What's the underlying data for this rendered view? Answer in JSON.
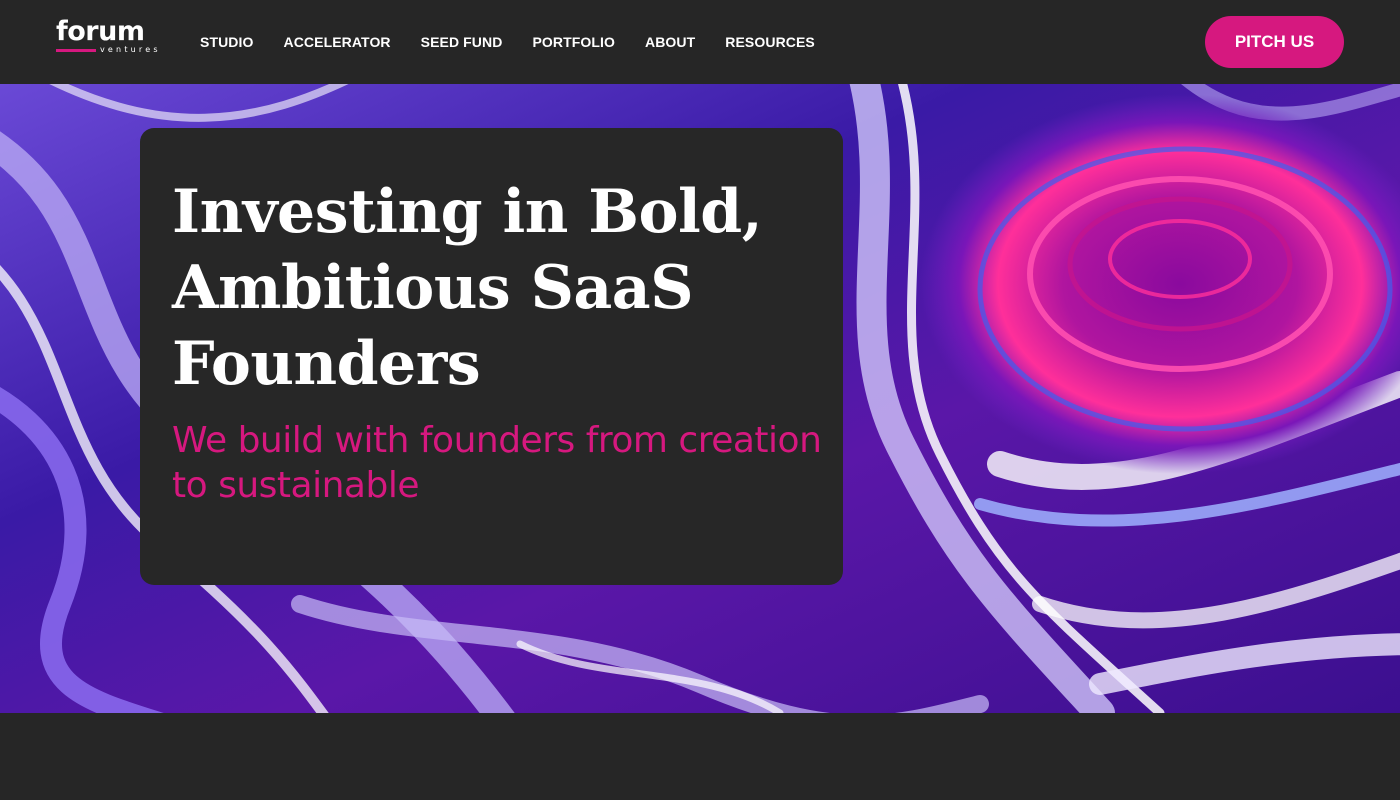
{
  "brand": {
    "name": "forum",
    "tagline": "ventures",
    "accent_color": "#d6187f",
    "background_color": "#262626"
  },
  "nav": {
    "items": [
      {
        "label": "STUDIO"
      },
      {
        "label": "ACCELERATOR"
      },
      {
        "label": "SEED FUND"
      },
      {
        "label": "PORTFOLIO"
      },
      {
        "label": "ABOUT"
      },
      {
        "label": "RESOURCES"
      }
    ],
    "cta_label": "PITCH US"
  },
  "hero": {
    "title": "Investing in Bold, Ambitious SaaS Founders",
    "subtitle": "We build with founders from creation to sustainable",
    "background": "marbled purple, magenta and white fluid paint"
  }
}
